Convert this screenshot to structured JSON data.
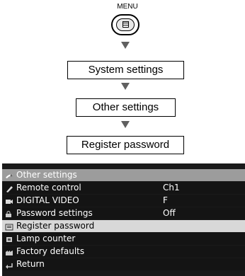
{
  "diagram": {
    "menu_label": "MENU",
    "steps": [
      "System settings",
      "Other settings",
      "Register password"
    ]
  },
  "osd": {
    "title": {
      "icon": "settings-icon",
      "label": "Other settings"
    },
    "items": [
      {
        "icon": "remote-control-icon",
        "label": "Remote control",
        "value": "Ch1",
        "selected": false
      },
      {
        "icon": "digital-video-icon",
        "label": "DIGITAL VIDEO",
        "value": "F",
        "selected": false
      },
      {
        "icon": "password-settings-icon",
        "label": "Password settings",
        "value": "Off",
        "selected": false
      },
      {
        "icon": "register-password-icon",
        "label": "Register password",
        "value": "",
        "selected": true
      },
      {
        "icon": "lamp-counter-icon",
        "label": "Lamp counter",
        "value": "",
        "selected": false
      },
      {
        "icon": "factory-defaults-icon",
        "label": "Factory defaults",
        "value": "",
        "selected": false
      },
      {
        "icon": "return-icon",
        "label": "Return",
        "value": "",
        "selected": false
      }
    ]
  },
  "colors": {
    "panel_bg": "#1a1a1a",
    "title_bar": "#9c9c9c",
    "selected_row": "#d8d8d8",
    "arrow": "#606060"
  }
}
